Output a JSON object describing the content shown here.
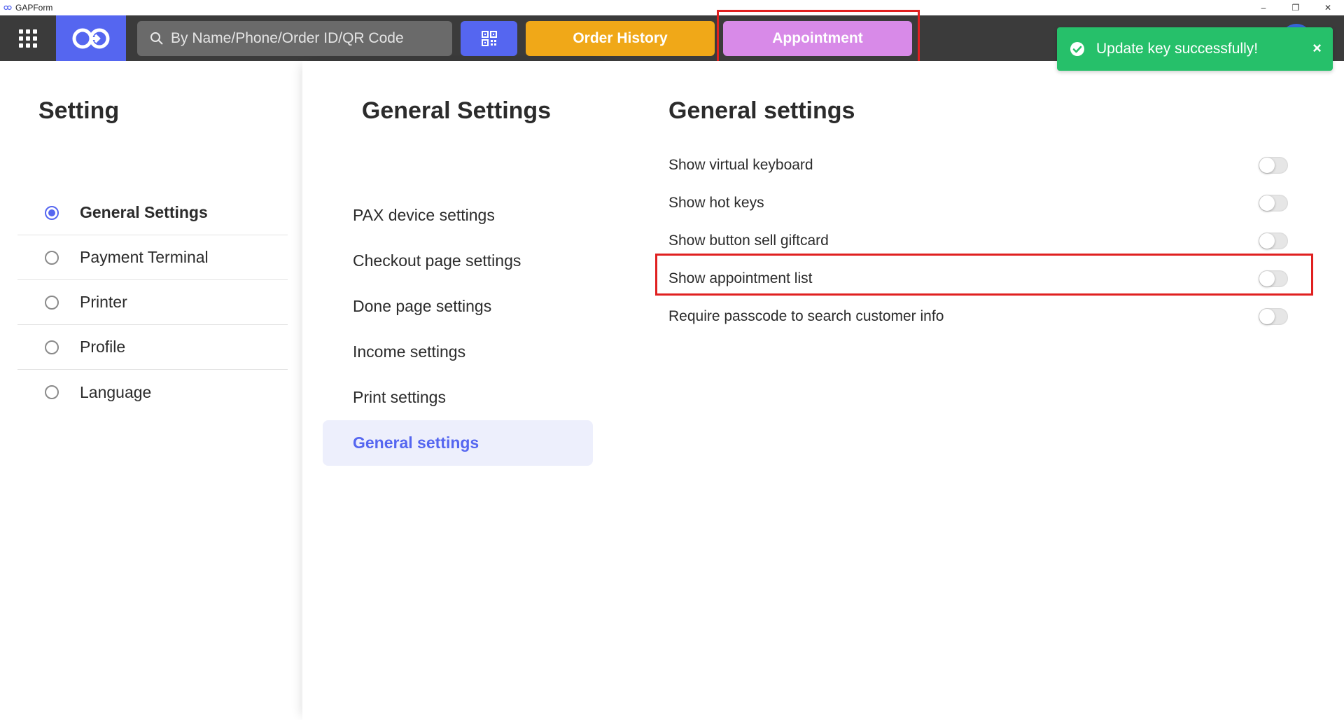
{
  "window": {
    "title": "GAPForm",
    "controls": [
      "–",
      "❐",
      "✕"
    ]
  },
  "topnav": {
    "search_placeholder": "By Name/Phone/Order ID/QR Code",
    "order_history_label": "Order History",
    "appointment_label": "Appointment"
  },
  "toast": {
    "message": "Update key successfully!",
    "close": "×"
  },
  "left": {
    "title": "Setting",
    "items": [
      {
        "label": "General Settings",
        "selected": true
      },
      {
        "label": "Payment Terminal",
        "selected": false
      },
      {
        "label": "Printer",
        "selected": false
      },
      {
        "label": "Profile",
        "selected": false
      },
      {
        "label": "Language",
        "selected": false
      }
    ]
  },
  "middle": {
    "title": "General Settings",
    "items": [
      {
        "label": "PAX device settings"
      },
      {
        "label": "Checkout page settings"
      },
      {
        "label": "Done page settings"
      },
      {
        "label": "Income settings"
      },
      {
        "label": "Print settings"
      },
      {
        "label": "General settings",
        "active": true
      }
    ]
  },
  "right": {
    "title": "General settings",
    "settings": [
      {
        "label": "Show virtual keyboard",
        "enabled": false
      },
      {
        "label": "Show hot keys",
        "enabled": false
      },
      {
        "label": "Show button sell giftcard",
        "enabled": false
      },
      {
        "label": "Show appointment list",
        "enabled": false
      },
      {
        "label": "Require passcode to search customer info",
        "enabled": false
      }
    ]
  },
  "colors": {
    "accent": "#5566f0",
    "nav_bg": "#3b3b3b",
    "order_history": "#f0a818",
    "appointment": "#d88ae8",
    "toast": "#26c06a",
    "highlight": "#e02020"
  }
}
